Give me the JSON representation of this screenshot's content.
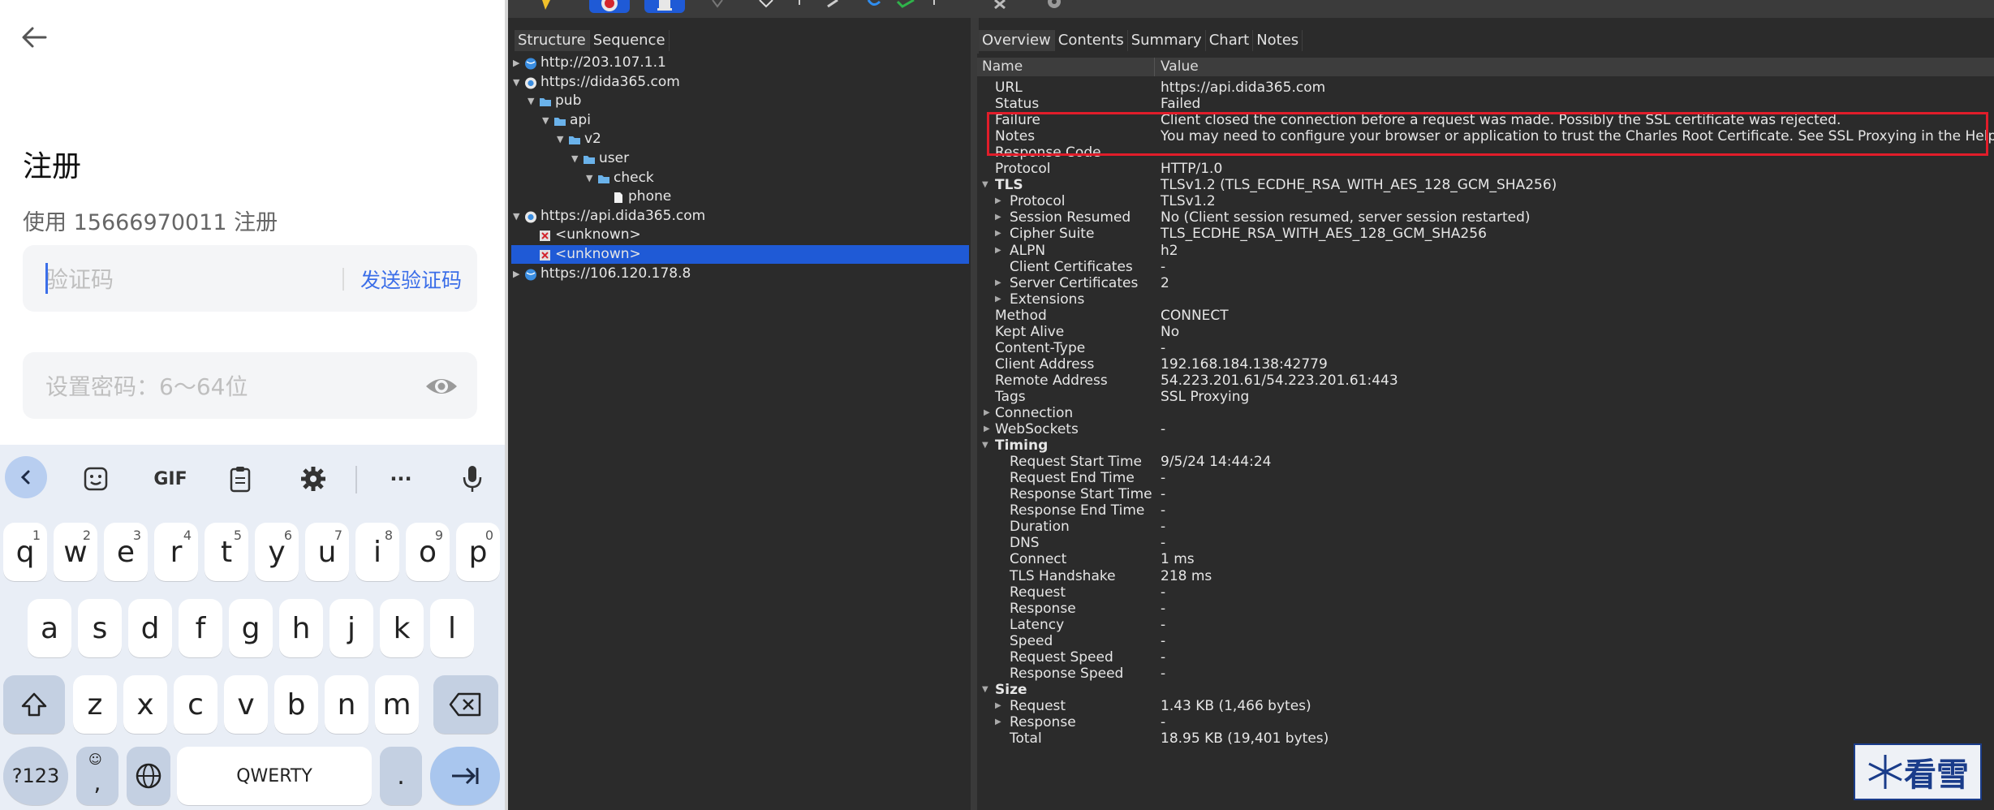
{
  "phone": {
    "title": "注册",
    "subtitle": "使用 15666970011 注册",
    "code_field": {
      "placeholder": "验证码",
      "send_label": "发送验证码"
    },
    "password_field": {
      "placeholder": "设置密码：6～64位"
    },
    "keyboard": {
      "toolbar": {
        "gif_label": "GIF",
        "more_label": "···"
      },
      "row1": [
        {
          "key": "q",
          "hint": "1"
        },
        {
          "key": "w",
          "hint": "2"
        },
        {
          "key": "e",
          "hint": "3"
        },
        {
          "key": "r",
          "hint": "4"
        },
        {
          "key": "t",
          "hint": "5"
        },
        {
          "key": "y",
          "hint": "6"
        },
        {
          "key": "u",
          "hint": "7"
        },
        {
          "key": "i",
          "hint": "8"
        },
        {
          "key": "o",
          "hint": "9"
        },
        {
          "key": "p",
          "hint": "0"
        }
      ],
      "row2": [
        "a",
        "s",
        "d",
        "f",
        "g",
        "h",
        "j",
        "k",
        "l"
      ],
      "row3": [
        "z",
        "x",
        "c",
        "v",
        "b",
        "n",
        "m"
      ],
      "symbols_label": "?123",
      "emoji_comma_label": ",",
      "space_label": "QWERTY",
      "period_label": "."
    }
  },
  "charles": {
    "left_tabs": [
      "Structure",
      "Sequence"
    ],
    "right_tabs": [
      "Overview",
      "Contents",
      "Summary",
      "Chart",
      "Notes"
    ],
    "tree": [
      {
        "label": "http://203.107.1.1",
        "depth": 0,
        "expanded": false,
        "icon": "globe-icon"
      },
      {
        "label": "https://dida365.com",
        "depth": 0,
        "expanded": true,
        "icon": "lock-globe-icon"
      },
      {
        "label": "pub",
        "depth": 1,
        "expanded": true,
        "icon": "folder-icon"
      },
      {
        "label": "api",
        "depth": 2,
        "expanded": true,
        "icon": "folder-icon"
      },
      {
        "label": "v2",
        "depth": 3,
        "expanded": true,
        "icon": "folder-icon"
      },
      {
        "label": "user",
        "depth": 4,
        "expanded": true,
        "icon": "folder-icon"
      },
      {
        "label": "check",
        "depth": 5,
        "expanded": true,
        "icon": "folder-icon"
      },
      {
        "label": "phone",
        "depth": 6,
        "expanded": null,
        "icon": "file-icon"
      },
      {
        "label": "https://api.dida365.com",
        "depth": 0,
        "expanded": true,
        "icon": "lock-globe-icon"
      },
      {
        "label": "<unknown>",
        "depth": 1,
        "expanded": null,
        "icon": "error-icon"
      },
      {
        "label": "<unknown>",
        "depth": 1,
        "expanded": null,
        "icon": "error-icon",
        "selected": true
      },
      {
        "label": "https://106.120.178.8",
        "depth": 0,
        "expanded": false,
        "icon": "globe-icon"
      }
    ],
    "detail_headers": {
      "name": "Name",
      "value": "Value"
    },
    "detail_rows": [
      {
        "name": "URL",
        "value": "https://api.dida365.com",
        "indent": 1
      },
      {
        "name": "Status",
        "value": "Failed",
        "indent": 1
      },
      {
        "name": "Failure",
        "value": "Client closed the connection before a request was made. Possibly the SSL certificate was rejected.",
        "indent": 1
      },
      {
        "name": "Notes",
        "value": "You may need to configure your browser or application to trust the Charles Root Certificate. See SSL Proxying in the Help menu.",
        "indent": 1
      },
      {
        "name": "Response Code",
        "value": "",
        "indent": 1
      },
      {
        "name": "Protocol",
        "value": "HTTP/1.0",
        "indent": 1
      },
      {
        "name": "TLS",
        "value": "TLSv1.2 (TLS_ECDHE_RSA_WITH_AES_128_GCM_SHA256)",
        "indent": 0,
        "tri": "open",
        "bold": true
      },
      {
        "name": "Protocol",
        "value": "TLSv1.2",
        "indent": 2,
        "tri": "closed"
      },
      {
        "name": "Session Resumed",
        "value": "No (Client session resumed, server session restarted)",
        "indent": 2,
        "tri": "closed"
      },
      {
        "name": "Cipher Suite",
        "value": "TLS_ECDHE_RSA_WITH_AES_128_GCM_SHA256",
        "indent": 2,
        "tri": "closed"
      },
      {
        "name": "ALPN",
        "value": "h2",
        "indent": 2,
        "tri": "closed"
      },
      {
        "name": "Client Certificates",
        "value": "-",
        "indent": 2
      },
      {
        "name": "Server Certificates",
        "value": "2",
        "indent": 2,
        "tri": "closed"
      },
      {
        "name": "Extensions",
        "value": "",
        "indent": 2,
        "tri": "closed"
      },
      {
        "name": "Method",
        "value": "CONNECT",
        "indent": 1
      },
      {
        "name": "Kept Alive",
        "value": "No",
        "indent": 1
      },
      {
        "name": "Content-Type",
        "value": "-",
        "indent": 1
      },
      {
        "name": "Client Address",
        "value": "192.168.184.138:42779",
        "indent": 1
      },
      {
        "name": "Remote Address",
        "value": "54.223.201.61/54.223.201.61:443",
        "indent": 1
      },
      {
        "name": "Tags",
        "value": "SSL Proxying",
        "indent": 1
      },
      {
        "name": "Connection",
        "value": "",
        "indent": 1,
        "tri": "closed"
      },
      {
        "name": "WebSockets",
        "value": "-",
        "indent": 1,
        "tri": "closed"
      },
      {
        "name": "Timing",
        "value": "",
        "indent": 0,
        "tri": "open",
        "bold": true
      },
      {
        "name": "Request Start Time",
        "value": "9/5/24 14:44:24",
        "indent": 2
      },
      {
        "name": "Request End Time",
        "value": "-",
        "indent": 2
      },
      {
        "name": "Response Start Time",
        "value": "-",
        "indent": 2
      },
      {
        "name": "Response End Time",
        "value": "-",
        "indent": 2
      },
      {
        "name": "Duration",
        "value": "-",
        "indent": 2
      },
      {
        "name": "DNS",
        "value": "-",
        "indent": 2
      },
      {
        "name": "Connect",
        "value": "1 ms",
        "indent": 2
      },
      {
        "name": "TLS Handshake",
        "value": "218 ms",
        "indent": 2
      },
      {
        "name": "Request",
        "value": "-",
        "indent": 2
      },
      {
        "name": "Response",
        "value": "-",
        "indent": 2
      },
      {
        "name": "Latency",
        "value": "-",
        "indent": 2
      },
      {
        "name": "Speed",
        "value": "-",
        "indent": 2
      },
      {
        "name": "Request Speed",
        "value": "-",
        "indent": 2
      },
      {
        "name": "Response Speed",
        "value": "-",
        "indent": 2
      },
      {
        "name": "Size",
        "value": "",
        "indent": 0,
        "tri": "open",
        "bold": true
      },
      {
        "name": "Request",
        "value": "1.43 KB (1,466 bytes)",
        "indent": 2,
        "tri": "closed"
      },
      {
        "name": "Response",
        "value": "-",
        "indent": 2,
        "tri": "closed"
      },
      {
        "name": "Total",
        "value": "18.95 KB (19,401 bytes)",
        "indent": 2
      }
    ],
    "colors": {
      "selection": "#1f5ad6",
      "highlight_box": "#e11d2a",
      "panel_bg": "#2b2b2b"
    }
  },
  "watermark": {
    "label": "看雪"
  }
}
